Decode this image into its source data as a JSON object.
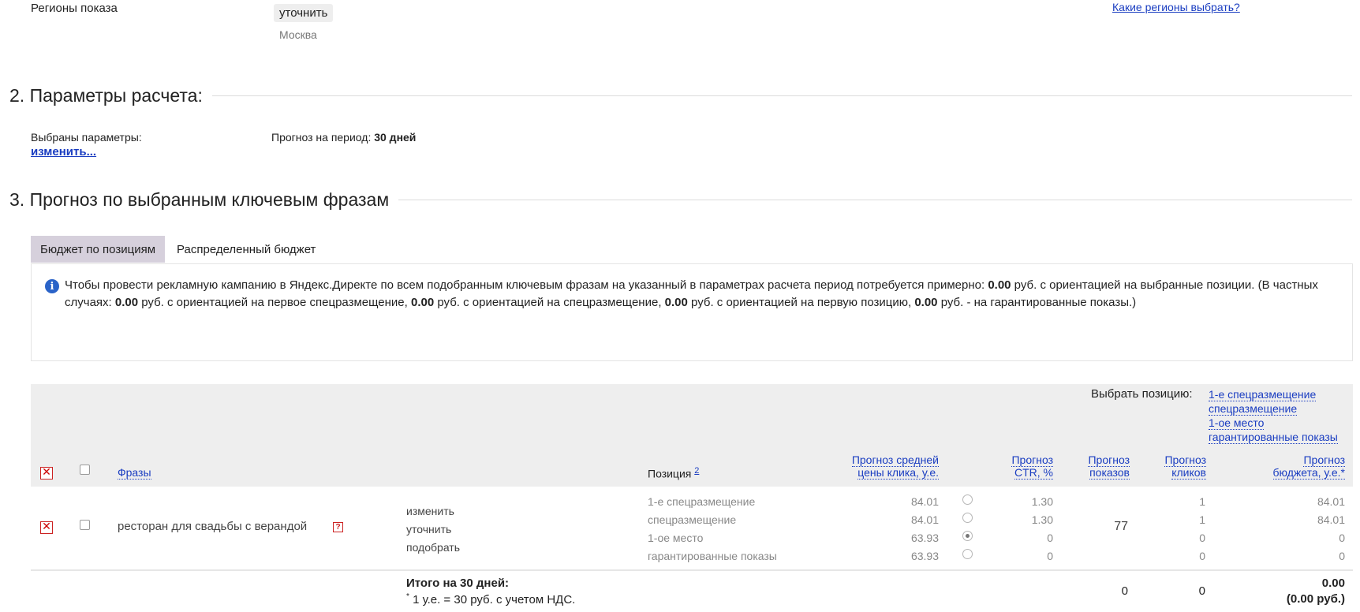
{
  "regions": {
    "label": "Регионы показа",
    "refine_button": "уточнить",
    "value": "Москва",
    "help_link": "Какие регионы выбрать?"
  },
  "section2": {
    "title": "2. Параметры расчета:",
    "selected_label": "Выбраны параметры:",
    "change_link": "изменить...",
    "period_label": "Прогноз на период:",
    "period_value": "30 дней"
  },
  "section3": {
    "title": "3. Прогноз по выбранным ключевым фразам",
    "tabs": [
      {
        "label": "Бюджет по позициям",
        "active": true
      },
      {
        "label": "Распределенный бюджет",
        "active": false
      }
    ],
    "info": {
      "t1": "Чтобы провести рекламную кампанию в Яндекс.Директе по всем подобранным ключевым фразам на указанный в параметрах расчета период потребуется примерно: ",
      "v1": "0.00",
      "t2": " руб. с ориентацией на выбранные позиции. (В частных случаях: ",
      "v2": "0.00",
      "t3": " руб. с ориентацией на первое спецразмещение, ",
      "v3": "0.00",
      "t4": " руб. с ориентацией на спецразмещение, ",
      "v4": "0.00",
      "t5": " руб. с ориентацией на первую позицию, ",
      "v5": "0.00",
      "t6": " руб. - на гарантированные показы.)"
    }
  },
  "table": {
    "select_position_label": "Выбрать позицию:",
    "position_options": [
      "1-е спецразмещение",
      "спецразмещение",
      "1-ое место",
      "гарантированные показы"
    ],
    "headers": {
      "phrases": "Фразы",
      "position": "Позиция",
      "position_note": "2",
      "avg_click_1": "Прогноз средней",
      "avg_click_2": "цены клика, у.е.",
      "ctr_1": "Прогноз",
      "ctr_2": "CTR, %",
      "shows_1": "Прогноз",
      "shows_2": "показов",
      "clicks_1": "Прогноз",
      "clicks_2": "кликов",
      "budget_1": "Прогноз",
      "budget_2": "бюджета, у.е.*"
    },
    "row": {
      "phrase": "ресторан для свадьбы с верандой",
      "help_icon": "question-icon",
      "actions": [
        "изменить",
        "уточнить",
        "подобрать"
      ],
      "shows": "77",
      "positions": [
        {
          "name": "1-е спецразмещение",
          "price": "84.01",
          "ctr": "1.30",
          "clicks": "1",
          "budget": "84.01",
          "selected": false
        },
        {
          "name": "спецразмещение",
          "price": "84.01",
          "ctr": "1.30",
          "clicks": "1",
          "budget": "84.01",
          "selected": false
        },
        {
          "name": "1-ое место",
          "price": "63.93",
          "ctr": "0",
          "clicks": "0",
          "budget": "0",
          "selected": true
        },
        {
          "name": "гарантированные показы",
          "price": "63.93",
          "ctr": "0",
          "clicks": "0",
          "budget": "0",
          "selected": false
        }
      ]
    },
    "totals": {
      "label": "Итого на 30 дней:",
      "footnote_mark": "*",
      "footnote": " 1 у.е. = 30 руб. с учетом НДС.",
      "shows": "0",
      "clicks": "0",
      "budget": "0.00",
      "budget_rub": "(0.00 руб.)"
    }
  },
  "icons": {
    "info": "info-icon",
    "delete": "delete-x-icon",
    "help": "question-icon"
  },
  "colors": {
    "link": "#1a3dc1",
    "active_tab": "#d6d0dc",
    "header_bg": "#eeeeee",
    "delete_red": "#cc0000"
  }
}
